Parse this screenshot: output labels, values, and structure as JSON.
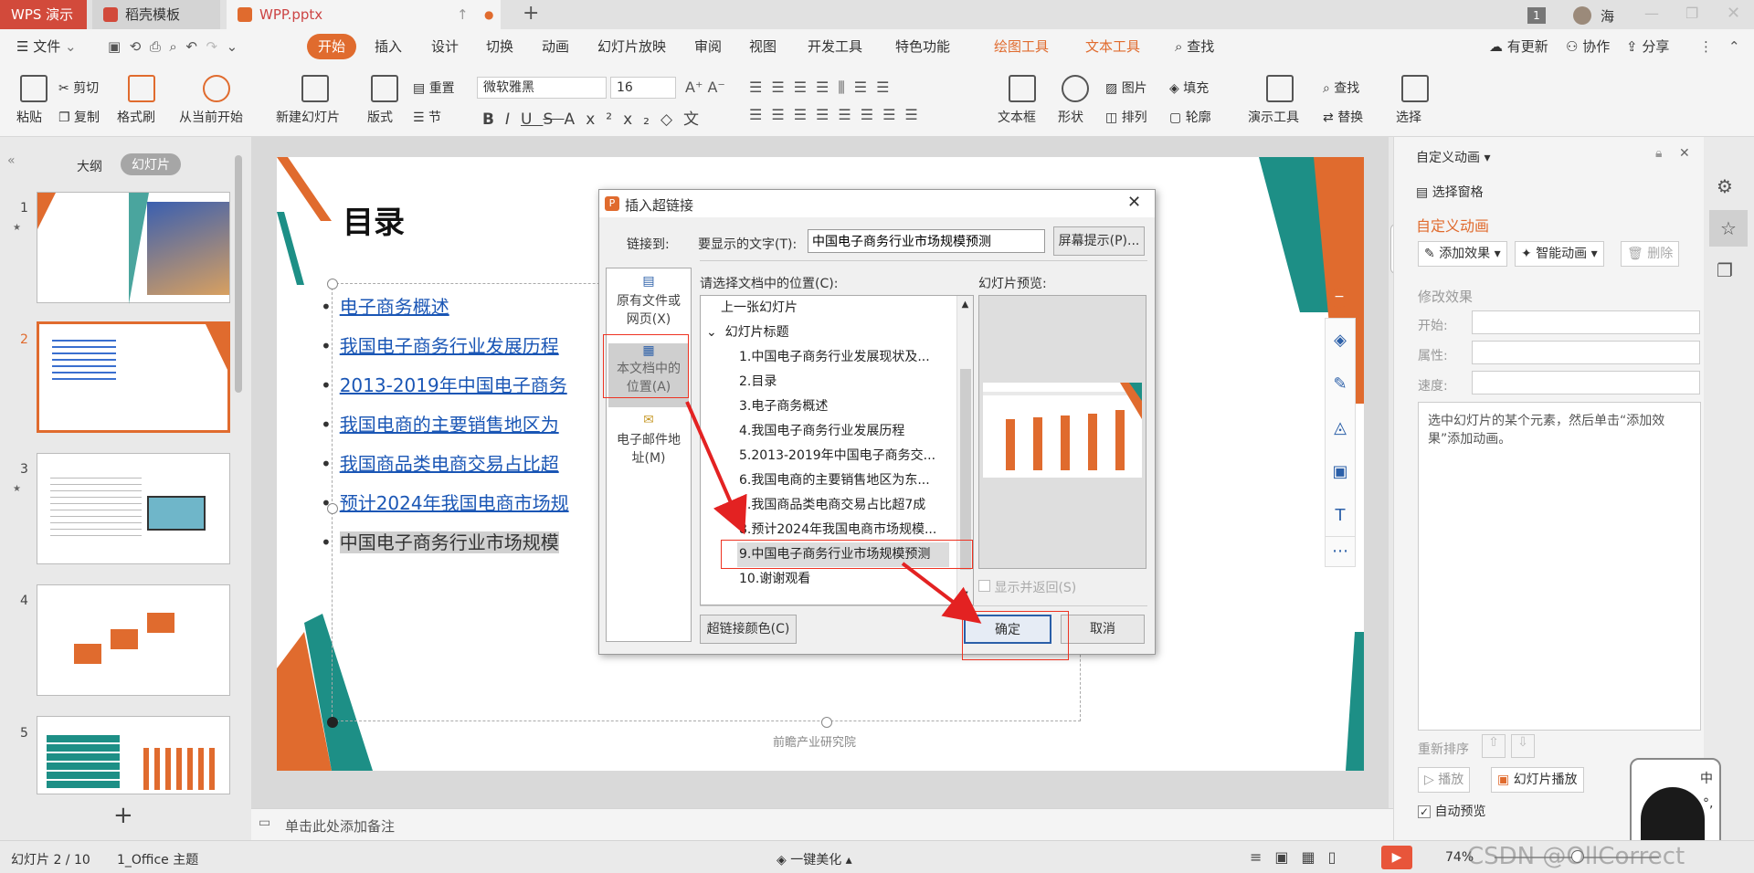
{
  "titlebar": {
    "tabs": [
      "WPS 演示",
      "稻壳模板",
      "WPP.pptx"
    ],
    "new_tab": "+",
    "badge": "1",
    "user": "海"
  },
  "menu": {
    "file": "文件",
    "items": [
      "开始",
      "插入",
      "设计",
      "切换",
      "动画",
      "幻灯片放映",
      "审阅",
      "视图",
      "开发工具",
      "特色功能"
    ],
    "orange_items": [
      "绘图工具",
      "文本工具"
    ],
    "search": "查找",
    "right": [
      "有更新",
      "协作",
      "分享"
    ]
  },
  "ribbon": {
    "paste": "粘贴",
    "cut": "剪切",
    "copy": "复制",
    "format_painter": "格式刷",
    "from_current": "从当前开始",
    "new_slide": "新建幻灯片",
    "layout": "版式",
    "reset": "重置",
    "section": "节",
    "font_name": "微软雅黑",
    "font_size": "16",
    "textbox": "文本框",
    "shape": "形状",
    "picture": "图片",
    "fill": "填充",
    "arrange": "排列",
    "outline": "轮廓",
    "presenter": "演示工具",
    "find": "查找",
    "replace": "替换",
    "select": "选择"
  },
  "leftpane": {
    "tab_outline": "大纲",
    "tab_slides": "幻灯片",
    "numbers": [
      "1",
      "2",
      "3",
      "4",
      "5"
    ],
    "add": "+"
  },
  "slide": {
    "title": "目录",
    "items": [
      "电子商务概述",
      "我国电子商务行业发展历程",
      "2013-2019年中国电子商务",
      "我国电商的主要销售地区为",
      "我国商品类电商交易占比超",
      "预计2024年我国电商市场规",
      "中国电子商务行业市场规模"
    ],
    "footer": "前瞻产业研究院"
  },
  "notes": "单击此处添加备注",
  "rightpane": {
    "title": "自定义动画",
    "select_pane": "选择窗格",
    "section_title": "自定义动画",
    "add_effect": "添加效果",
    "smart_anim": "智能动画",
    "delete": "删除",
    "modify": "修改效果",
    "start": "开始:",
    "property": "属性:",
    "speed": "速度:",
    "hint": "选中幻灯片的某个元素，然后单击“添加效果”添加动画。",
    "reorder": "重新排序",
    "play": "播放",
    "slideshow": "幻灯片播放",
    "autopreview": "自动预览"
  },
  "dialog": {
    "title": "插入超链接",
    "link_to": "链接到:",
    "display_text_label": "要显示的文字(T):",
    "display_text_value": "中国电子商务行业市场规模预测",
    "screen_tip": "屏幕提示(P)...",
    "nav": [
      "原有文件或网页(X)",
      "本文档中的位置(A)",
      "电子邮件地址(M)"
    ],
    "select_label": "请选择文档中的位置(C):",
    "preview_label": "幻灯片预览:",
    "list": [
      "上一张幻灯片",
      "幻灯片标题",
      "1.中国电子商务行业发展现状及...",
      "2.目录",
      "3.电子商务概述",
      "4.我国电子商务行业发展历程",
      "5.2013-2019年中国电子商务交...",
      "6.我国电商的主要销售地区为东...",
      "7.我国商品类电商交易占比超7成",
      "8.预计2024年我国电商市场规模...",
      "9.中国电子商务行业市场规模预测",
      "10.谢谢观看"
    ],
    "show_return": "显示并返回(S)",
    "link_color": "超链接颜色(C)",
    "ok": "确定",
    "cancel": "取消"
  },
  "statusbar": {
    "slide_info": "幻灯片 2 / 10",
    "theme": "1_Office 主题",
    "beautify": "一键美化",
    "zoom": "74%",
    "watermark": "CSDN @OllCorrect"
  },
  "colors": {
    "accent": "#e06b2e",
    "teal": "#1d8f86",
    "link": "#1a56b5",
    "red_annotation": "#e32222"
  }
}
